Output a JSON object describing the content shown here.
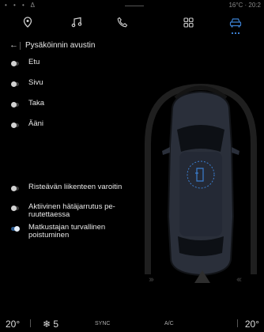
{
  "status": {
    "signal": "• • • Δ",
    "temp_time": "16°C · 20:2"
  },
  "nav": {
    "icons": [
      "location-icon",
      "music-icon",
      "phone-icon",
      "apps-icon",
      "car-icon"
    ],
    "active": "car-icon"
  },
  "header": {
    "back": "←",
    "title": "Pysäköinnin avustin"
  },
  "settings": [
    {
      "label": "Etu",
      "on": false
    },
    {
      "label": "Sivu",
      "on": false
    },
    {
      "label": "Taka",
      "on": false
    },
    {
      "label": "Ääni",
      "on": false
    },
    {
      "label": "Risteävän liikenteen varoitin",
      "on": false
    },
    {
      "label": "Aktiivinen hätäjarrutus pe-\nruutettaessa",
      "on": false
    },
    {
      "label": "Matkustajan turvallinen\npoistuminen",
      "on": true
    }
  ],
  "visual": {
    "left_arrows": "›››",
    "right_arrows": "‹‹‹",
    "warning": "!"
  },
  "bottom": {
    "temp_left": "20°",
    "fan": "❄ 5",
    "sync": "SYNC",
    "ac": "A/C",
    "temp_right": "20°"
  },
  "colors": {
    "accent": "#3b7fd0",
    "toggle_on": "#2b5a8f"
  }
}
